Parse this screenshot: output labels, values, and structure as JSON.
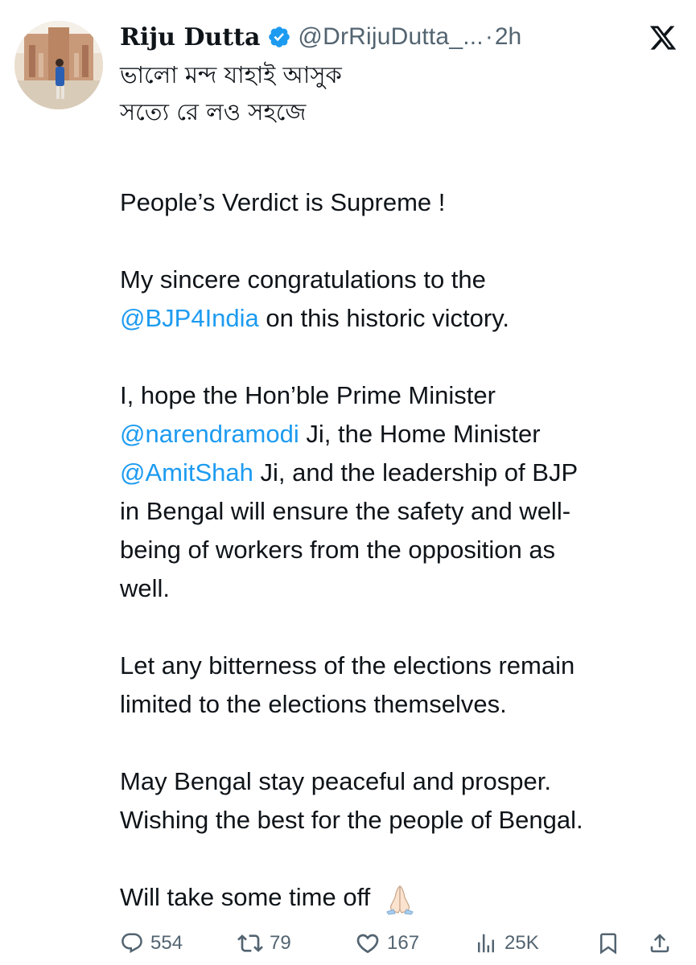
{
  "user": {
    "display_name": "Riju Dutta",
    "handle": "@DrRijuDutta_...",
    "separator": "·",
    "time": "2h",
    "verified": true,
    "avatar_icon": "avatar-photo"
  },
  "tweet": {
    "bengali_lines": [
      "ভালো মন্দ যাহাই আসুক",
      "সত্যে রে লও সহজে"
    ],
    "p1": "People’s Verdict is Supreme !",
    "p2": {
      "t1": "My sincere congratulations to the",
      "mention": "@BJP4India",
      "t2": " on this historic victory."
    },
    "p3": {
      "t1": "I, hope the Hon’ble Prime Minister",
      "mention1": "@narendramodi",
      "t2": " Ji, the Home Minister",
      "mention2": "@AmitShah",
      "t3": " Ji, and the leadership of BJP",
      "t4": "in Bengal will ensure the safety and well-",
      "t5": "being of workers from the opposition as",
      "t6": "well."
    },
    "p4": {
      "l1": "Let any bitterness of the elections remain",
      "l2": "limited to the elections themselves."
    },
    "p5": {
      "l1": "May Bengal stay peaceful and prosper.",
      "l2": "Wishing the best for the people of Bengal."
    },
    "p6": "Will take some time off",
    "emoji": "folded-hands-icon"
  },
  "actions": {
    "replies": "554",
    "reposts": "79",
    "likes": "167",
    "views": "25K"
  },
  "colors": {
    "text": "#0f1419",
    "secondary": "#536471",
    "link": "#1d9bf0",
    "verified": "#1d9bf0"
  }
}
